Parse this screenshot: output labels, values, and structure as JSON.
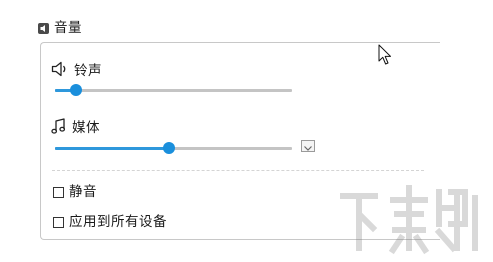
{
  "section": {
    "title": "音量",
    "icon": "volume-section-icon"
  },
  "ringtone": {
    "label": "铃声",
    "icon": "speaker-icon",
    "level": 0.09
  },
  "media": {
    "label": "媒体",
    "icon": "music-note-icon",
    "level": 0.48,
    "dropdown_icon": "chevron-down-icon"
  },
  "options": {
    "mute": {
      "label": "静音",
      "checked": false
    },
    "apply_all": {
      "label": "应用到所有设备",
      "checked": false
    }
  },
  "watermark": {
    "text": "下载吧"
  },
  "colors": {
    "accent": "#1a8fdc",
    "track": "#c4c4c4",
    "border": "#c8c8c8"
  }
}
